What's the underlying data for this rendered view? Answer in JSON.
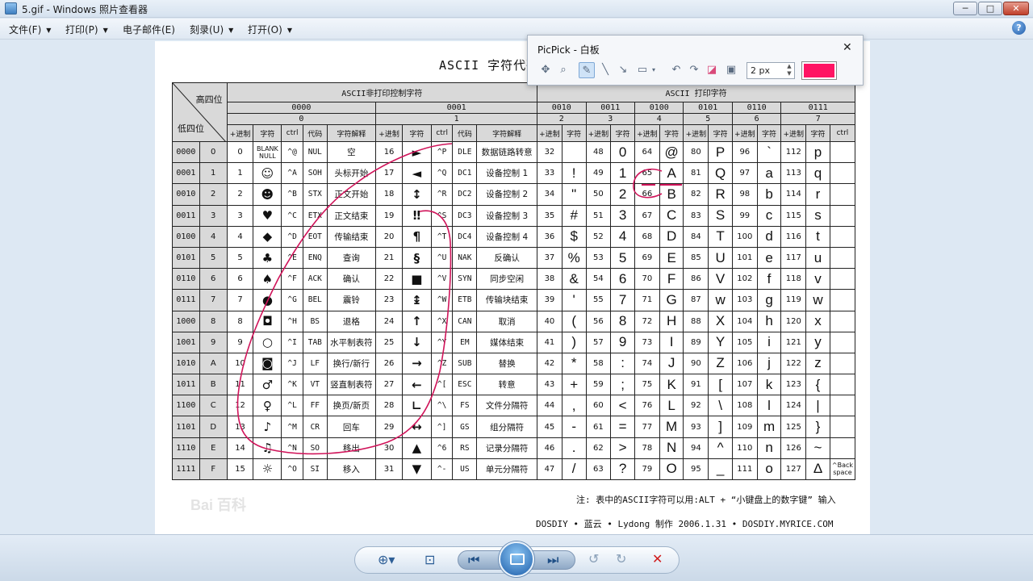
{
  "window": {
    "title": "5.gif - Windows 照片查看器",
    "min": "─",
    "max": "□",
    "close": "✕"
  },
  "menu": [
    "文件(F)",
    "打印(P)",
    "电子邮件(E)",
    "刻录(U)",
    "打开(O)"
  ],
  "doc": {
    "title": "ASCII 字符代码表",
    "corner_high": "高四位",
    "corner_low": "低四位",
    "group_ctrl": "ASCII非打印控制字符",
    "group_print": "ASCII 打印字符",
    "hi_bins": [
      "0000",
      "0001",
      "0010",
      "0011",
      "0100",
      "0101",
      "0110",
      "0111"
    ],
    "hi_hex": [
      "0",
      "1",
      "2",
      "3",
      "4",
      "5",
      "6",
      "7"
    ],
    "sub_ctrl": [
      "+进制",
      "字符",
      "ctrl",
      "代码",
      "字符解释"
    ],
    "sub_print": [
      "+进制",
      "字符"
    ],
    "ctrl_last": "ctrl",
    "rows": [
      {
        "bin": "0000",
        "hex": "0",
        "c0": [
          "0",
          "BLANK NULL",
          "^@",
          "NUL",
          "空"
        ],
        "c1": [
          "16",
          "►",
          "^P",
          "DLE",
          "数据链路转意"
        ],
        "p": [
          [
            "32",
            ""
          ],
          [
            "48",
            "0"
          ],
          [
            "64",
            "@"
          ],
          [
            "80",
            "P"
          ],
          [
            "96",
            "`"
          ],
          [
            "112",
            "p"
          ]
        ],
        "z": ""
      },
      {
        "bin": "0001",
        "hex": "1",
        "c0": [
          "1",
          "☺",
          "^A",
          "SOH",
          "头标开始"
        ],
        "c1": [
          "17",
          "◄",
          "^Q",
          "DC1",
          "设备控制 1"
        ],
        "p": [
          [
            "33",
            "!"
          ],
          [
            "49",
            "1"
          ],
          [
            "65",
            "A"
          ],
          [
            "81",
            "Q"
          ],
          [
            "97",
            "a"
          ],
          [
            "113",
            "q"
          ]
        ],
        "z": ""
      },
      {
        "bin": "0010",
        "hex": "2",
        "c0": [
          "2",
          "☻",
          "^B",
          "STX",
          "正文开始"
        ],
        "c1": [
          "18",
          "↕",
          "^R",
          "DC2",
          "设备控制 2"
        ],
        "p": [
          [
            "34",
            "\""
          ],
          [
            "50",
            "2"
          ],
          [
            "66",
            "B"
          ],
          [
            "82",
            "R"
          ],
          [
            "98",
            "b"
          ],
          [
            "114",
            "r"
          ]
        ],
        "z": ""
      },
      {
        "bin": "0011",
        "hex": "3",
        "c0": [
          "3",
          "♥",
          "^C",
          "ETX",
          "正文结束"
        ],
        "c1": [
          "19",
          "‼",
          "^S",
          "DC3",
          "设备控制 3"
        ],
        "p": [
          [
            "35",
            "#"
          ],
          [
            "51",
            "3"
          ],
          [
            "67",
            "C"
          ],
          [
            "83",
            "S"
          ],
          [
            "99",
            "c"
          ],
          [
            "115",
            "s"
          ]
        ],
        "z": ""
      },
      {
        "bin": "0100",
        "hex": "4",
        "c0": [
          "4",
          "◆",
          "^D",
          "EOT",
          "传输结束"
        ],
        "c1": [
          "20",
          "¶",
          "^T",
          "DC4",
          "设备控制 4"
        ],
        "p": [
          [
            "36",
            "$"
          ],
          [
            "52",
            "4"
          ],
          [
            "68",
            "D"
          ],
          [
            "84",
            "T"
          ],
          [
            "100",
            "d"
          ],
          [
            "116",
            "t"
          ]
        ],
        "z": ""
      },
      {
        "bin": "0101",
        "hex": "5",
        "c0": [
          "5",
          "♣",
          "^E",
          "ENQ",
          "查询"
        ],
        "c1": [
          "21",
          "§",
          "^U",
          "NAK",
          "反确认"
        ],
        "p": [
          [
            "37",
            "%"
          ],
          [
            "53",
            "5"
          ],
          [
            "69",
            "E"
          ],
          [
            "85",
            "U"
          ],
          [
            "101",
            "e"
          ],
          [
            "117",
            "u"
          ]
        ],
        "z": ""
      },
      {
        "bin": "0110",
        "hex": "6",
        "c0": [
          "6",
          "♠",
          "^F",
          "ACK",
          "确认"
        ],
        "c1": [
          "22",
          "■",
          "^V",
          "SYN",
          "同步空闲"
        ],
        "p": [
          [
            "38",
            "&"
          ],
          [
            "54",
            "6"
          ],
          [
            "70",
            "F"
          ],
          [
            "86",
            "V"
          ],
          [
            "102",
            "f"
          ],
          [
            "118",
            "v"
          ]
        ],
        "z": ""
      },
      {
        "bin": "0111",
        "hex": "7",
        "c0": [
          "7",
          "●",
          "^G",
          "BEL",
          "震铃"
        ],
        "c1": [
          "23",
          "↨",
          "^W",
          "ETB",
          "传输块结束"
        ],
        "p": [
          [
            "39",
            "'"
          ],
          [
            "55",
            "7"
          ],
          [
            "71",
            "G"
          ],
          [
            "87",
            "w"
          ],
          [
            "103",
            "g"
          ],
          [
            "119",
            "w"
          ]
        ],
        "z": ""
      },
      {
        "bin": "1000",
        "hex": "8",
        "c0": [
          "8",
          "◘",
          "^H",
          "BS",
          "退格"
        ],
        "c1": [
          "24",
          "↑",
          "^X",
          "CAN",
          "取消"
        ],
        "p": [
          [
            "40",
            "("
          ],
          [
            "56",
            "8"
          ],
          [
            "72",
            "H"
          ],
          [
            "88",
            "X"
          ],
          [
            "104",
            "h"
          ],
          [
            "120",
            "x"
          ]
        ],
        "z": ""
      },
      {
        "bin": "1001",
        "hex": "9",
        "c0": [
          "9",
          "○",
          "^I",
          "TAB",
          "水平制表符"
        ],
        "c1": [
          "25",
          "↓",
          "^Y",
          "EM",
          "媒体结束"
        ],
        "p": [
          [
            "41",
            ")"
          ],
          [
            "57",
            "9"
          ],
          [
            "73",
            "I"
          ],
          [
            "89",
            "Y"
          ],
          [
            "105",
            "i"
          ],
          [
            "121",
            "y"
          ]
        ],
        "z": ""
      },
      {
        "bin": "1010",
        "hex": "A",
        "c0": [
          "10",
          "◙",
          "^J",
          "LF",
          "换行/新行"
        ],
        "c1": [
          "26",
          "→",
          "^Z",
          "SUB",
          "替换"
        ],
        "p": [
          [
            "42",
            "*"
          ],
          [
            "58",
            ":"
          ],
          [
            "74",
            "J"
          ],
          [
            "90",
            "Z"
          ],
          [
            "106",
            "j"
          ],
          [
            "122",
            "z"
          ]
        ],
        "z": ""
      },
      {
        "bin": "1011",
        "hex": "B",
        "c0": [
          "11",
          "♂",
          "^K",
          "VT",
          "竖直制表符"
        ],
        "c1": [
          "27",
          "←",
          "^[",
          "ESC",
          "转意"
        ],
        "p": [
          [
            "43",
            "+"
          ],
          [
            "59",
            ";"
          ],
          [
            "75",
            "K"
          ],
          [
            "91",
            "["
          ],
          [
            "107",
            "k"
          ],
          [
            "123",
            "{"
          ]
        ],
        "z": ""
      },
      {
        "bin": "1100",
        "hex": "C",
        "c0": [
          "12",
          "♀",
          "^L",
          "FF",
          "换页/新页"
        ],
        "c1": [
          "28",
          "∟",
          "^\\",
          "FS",
          "文件分隔符"
        ],
        "p": [
          [
            "44",
            ","
          ],
          [
            "60",
            "<"
          ],
          [
            "76",
            "L"
          ],
          [
            "92",
            "\\"
          ],
          [
            "108",
            "l"
          ],
          [
            "124",
            "|"
          ]
        ],
        "z": ""
      },
      {
        "bin": "1101",
        "hex": "D",
        "c0": [
          "13",
          "♪",
          "^M",
          "CR",
          "回车"
        ],
        "c1": [
          "29",
          "↔",
          "^]",
          "GS",
          "组分隔符"
        ],
        "p": [
          [
            "45",
            "-"
          ],
          [
            "61",
            "="
          ],
          [
            "77",
            "M"
          ],
          [
            "93",
            "]"
          ],
          [
            "109",
            "m"
          ],
          [
            "125",
            "}"
          ]
        ],
        "z": ""
      },
      {
        "bin": "1110",
        "hex": "E",
        "c0": [
          "14",
          "♫",
          "^N",
          "SO",
          "移出"
        ],
        "c1": [
          "30",
          "▲",
          "^6",
          "RS",
          "记录分隔符"
        ],
        "p": [
          [
            "46",
            "."
          ],
          [
            "62",
            ">"
          ],
          [
            "78",
            "N"
          ],
          [
            "94",
            "^"
          ],
          [
            "110",
            "n"
          ],
          [
            "126",
            "~"
          ]
        ],
        "z": ""
      },
      {
        "bin": "1111",
        "hex": "F",
        "c0": [
          "15",
          "☼",
          "^O",
          "SI",
          "移入"
        ],
        "c1": [
          "31",
          "▼",
          "^-",
          "US",
          "单元分隔符"
        ],
        "p": [
          [
            "47",
            "/"
          ],
          [
            "63",
            "?"
          ],
          [
            "79",
            "O"
          ],
          [
            "95",
            "_"
          ],
          [
            "111",
            "o"
          ],
          [
            "127",
            "Δ"
          ]
        ],
        "z": "^Back space"
      }
    ],
    "note": "注: 表中的ASCII字符可以用:ALT + “小键盘上的数字键” 输入",
    "credit": "DOSDIY • 蓝云 • Lydong 制作 2006.1.31 • DOSDIY.MYRICE.COM",
    "watermark": "Bai 百科"
  },
  "picpick": {
    "title": "PicPick - 白板",
    "close": "✕",
    "size": "2 px",
    "color": "#ff1463"
  },
  "ink_color": "#d0145a",
  "bottom": {
    "zoom": "⊕▾",
    "fit": "⊡",
    "prev": "⏮",
    "next": "⏭",
    "rot_left": "↺",
    "rot_right": "↻",
    "delete": "✕"
  }
}
